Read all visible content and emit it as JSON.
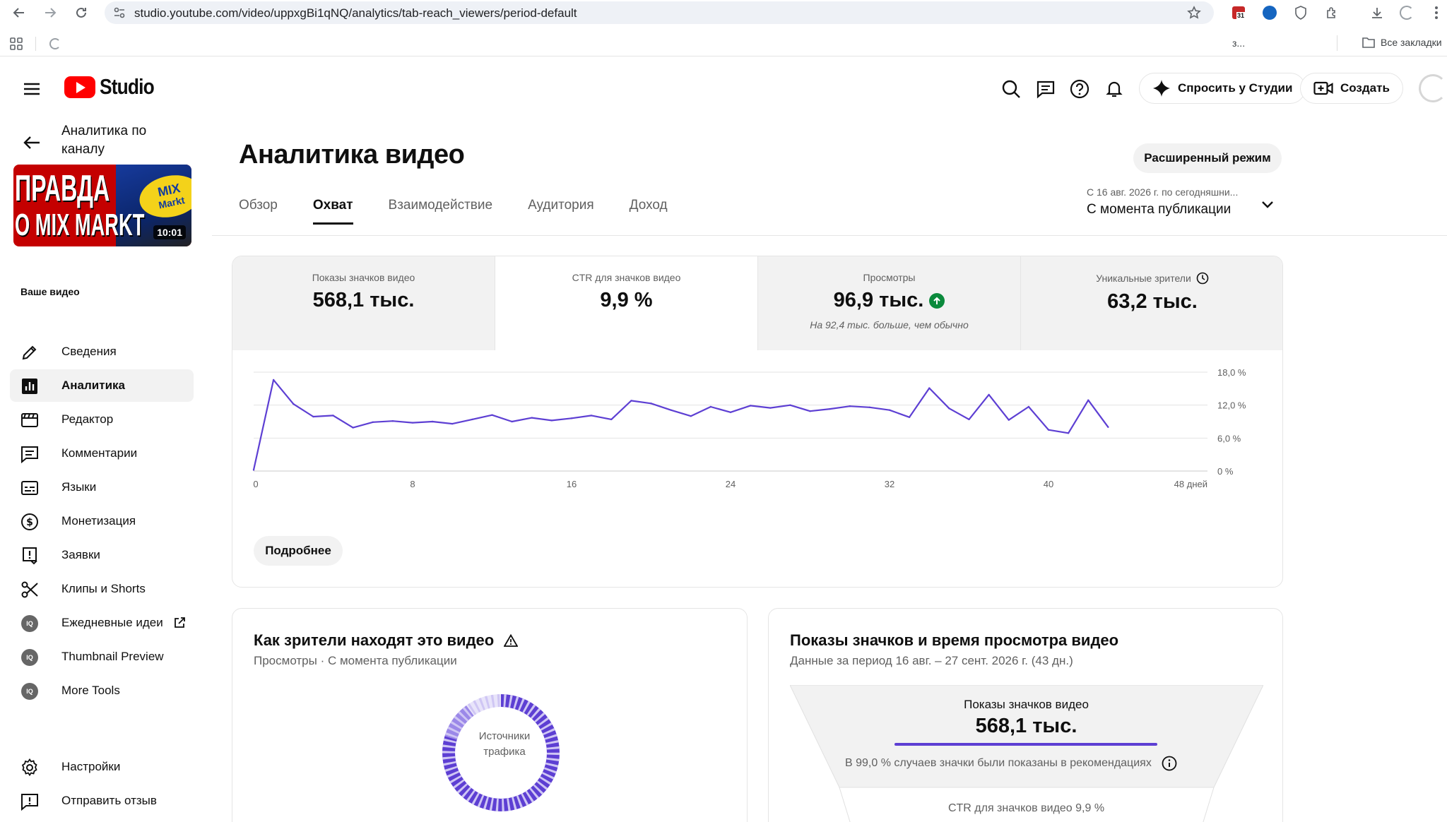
{
  "browser": {
    "url": "studio.youtube.com/video/uppxgBi1qNQ/analytics/tab-reach_viewers/period-default",
    "calendar_badge": "31",
    "bookmarks_truncated": "з...",
    "all_bookmarks": "Все закладки"
  },
  "header": {
    "logo_text": "Studio",
    "ask_studio": "Спросить у Студии",
    "create": "Создать"
  },
  "sidebar": {
    "channel_link": "Аналитика по каналу",
    "thumbnail": {
      "title_line1": "ПРАВДА",
      "title_line2": "О MIX MARKT",
      "logo_line1": "MIX",
      "logo_line2": "Markt",
      "duration": "10:01"
    },
    "your_video": "Ваше видео",
    "items": [
      {
        "label": "Сведения",
        "icon": "pencil-icon"
      },
      {
        "label": "Аналитика",
        "icon": "analytics-icon",
        "active": true
      },
      {
        "label": "Редактор",
        "icon": "editor-icon"
      },
      {
        "label": "Комментарии",
        "icon": "comments-icon"
      },
      {
        "label": "Языки",
        "icon": "subtitles-icon"
      },
      {
        "label": "Монетизация",
        "icon": "dollar-icon"
      },
      {
        "label": "Заявки",
        "icon": "claims-icon"
      },
      {
        "label": "Клипы и Shorts",
        "icon": "scissors-icon"
      },
      {
        "label": "Ежедневные идеи",
        "icon": "iq-icon"
      },
      {
        "label": "Thumbnail Preview",
        "icon": "iq-icon"
      },
      {
        "label": "More Tools",
        "icon": "iq-icon"
      }
    ],
    "settings": "Настройки",
    "feedback": "Отправить отзыв",
    "iq_badge": "IQ"
  },
  "main": {
    "title": "Аналитика видео",
    "advanced_mode": "Расширенный режим",
    "tabs": [
      {
        "label": "Обзор"
      },
      {
        "label": "Охват",
        "active": true
      },
      {
        "label": "Взаимодействие"
      },
      {
        "label": "Аудитория"
      },
      {
        "label": "Доход"
      }
    ],
    "period_sub": "С 16 авг. 2026 г. по сегодняшни...",
    "period_main": "С момента публикации"
  },
  "metrics": [
    {
      "label": "Показы значков видео",
      "value": "568,1 тыс."
    },
    {
      "label": "CTR для значков видео",
      "value": "9,9 %",
      "selected": true
    },
    {
      "label": "Просмотры",
      "value": "96,9 тыс.",
      "note": "На 92,4 тыс. больше, чем обычно",
      "trend": "up"
    },
    {
      "label": "Уникальные зрители",
      "value": "63,2 тыс.",
      "info_icon": "clock-icon"
    }
  ],
  "chart_data": {
    "type": "line",
    "title": "",
    "xlabel": "",
    "ylabel": "",
    "x_ticks": [
      "0",
      "8",
      "16",
      "24",
      "32",
      "40",
      "48 дней"
    ],
    "x_tick_values": [
      0,
      8,
      16,
      24,
      32,
      40,
      48
    ],
    "y_ticks": [
      "0 %",
      "6,0 %",
      "12,0 %",
      "18,0 %"
    ],
    "y_tick_values": [
      0,
      6,
      12,
      18
    ],
    "xlim": [
      0,
      48
    ],
    "ylim": [
      0,
      18
    ],
    "grid": true,
    "color": "#5d3fd3",
    "series": [
      {
        "x": [
          0,
          1,
          2,
          3,
          4,
          5,
          6,
          7,
          8,
          9,
          10,
          11,
          12,
          13,
          14,
          15,
          16,
          17,
          18,
          19,
          20,
          21,
          22,
          23,
          24,
          25,
          26,
          27,
          28,
          29,
          30,
          31,
          32,
          33,
          34,
          35,
          36,
          37,
          38,
          39,
          40,
          41,
          42,
          43
        ],
        "values": [
          0.2,
          16.6,
          12.2,
          9.9,
          10.1,
          7.9,
          8.9,
          9.1,
          8.8,
          9.0,
          8.6,
          9.4,
          10.2,
          9.0,
          9.7,
          9.2,
          9.6,
          10.1,
          9.4,
          12.8,
          12.3,
          11.1,
          10.0,
          11.7,
          10.7,
          11.9,
          11.5,
          12.0,
          10.9,
          11.3,
          11.8,
          11.6,
          11.1,
          9.8,
          15.1,
          11.4,
          9.4,
          13.9,
          9.3,
          11.7,
          7.5,
          6.9,
          12.9,
          8.0
        ]
      }
    ]
  },
  "more_button": "Подробнее",
  "traffic_card": {
    "title": "Как зрители находят это видео",
    "subtitle": "Просмотры · С момента публикации",
    "donut_label": "Источники трафика",
    "color": "#5d3fd3"
  },
  "funnel_card": {
    "title": "Показы значков и время просмотра видео",
    "subtitle": "Данные за период 16 авг. – 27 сент. 2026 г. (43 дн.)",
    "top_label": "Показы значков видео",
    "top_value": "568,1 тыс.",
    "top_note": "В 99,0 % случаев значки были показаны в рекомендациях",
    "ctr_label": "CTR для значков видео 9,9 %"
  }
}
